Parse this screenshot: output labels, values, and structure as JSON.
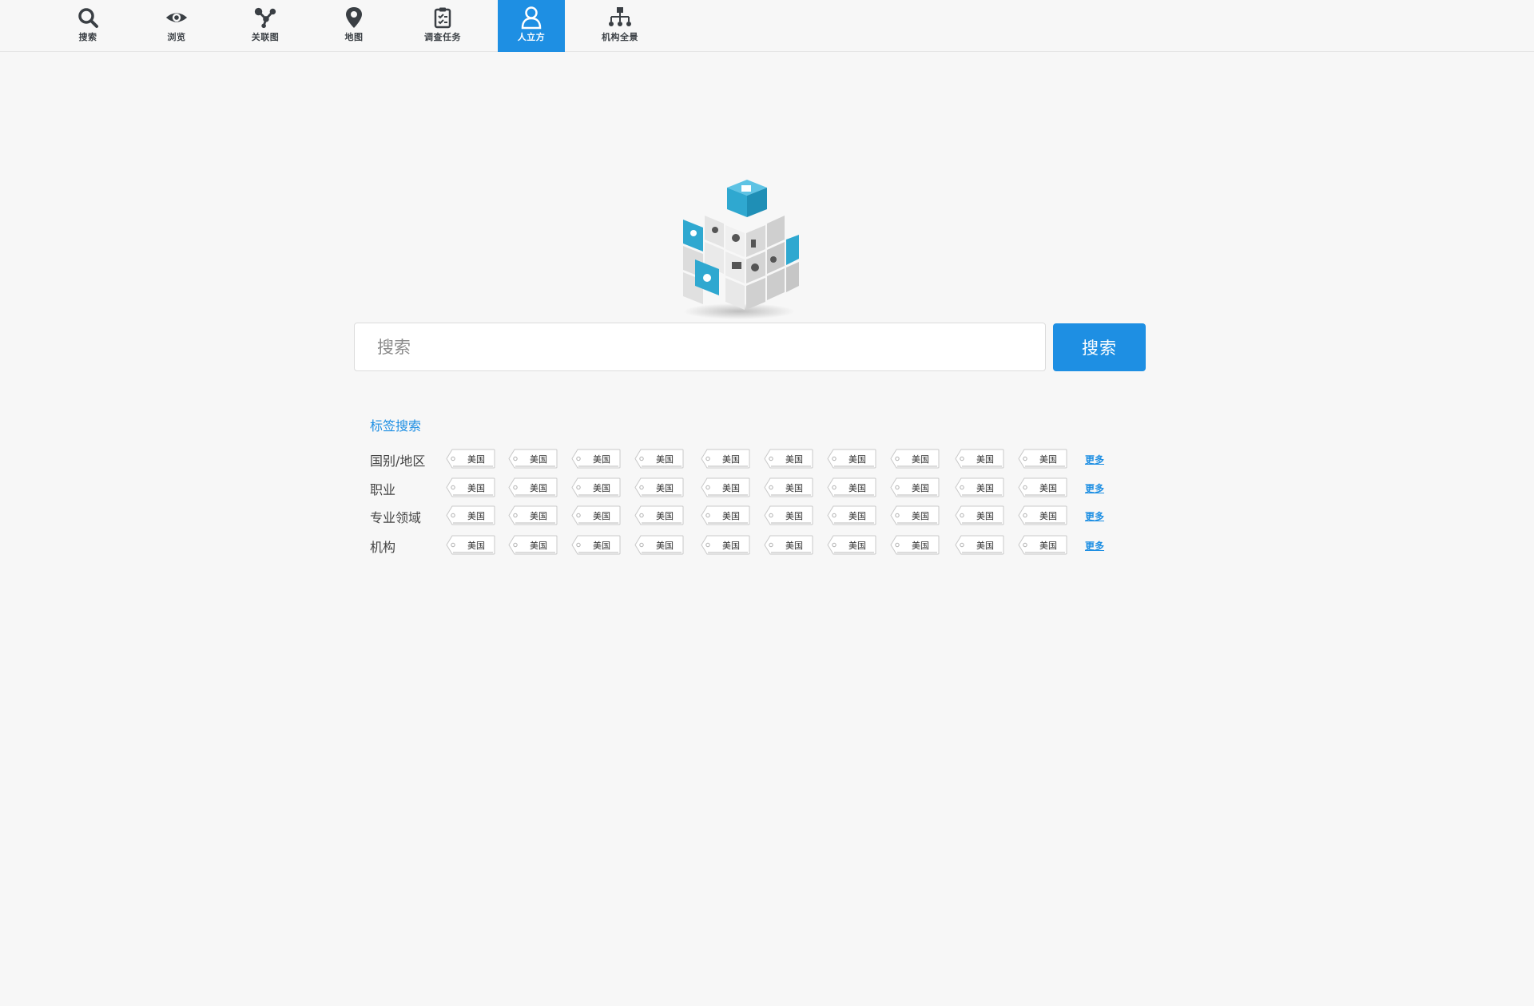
{
  "nav": {
    "items": [
      {
        "label": "搜索",
        "icon": "search-icon"
      },
      {
        "label": "浏览",
        "icon": "eye-icon"
      },
      {
        "label": "关联图",
        "icon": "graph-icon"
      },
      {
        "label": "地图",
        "icon": "map-pin-icon"
      },
      {
        "label": "调查任务",
        "icon": "clipboard-icon"
      },
      {
        "label": "人立方",
        "icon": "person-icon",
        "active": true
      },
      {
        "label": "机构全景",
        "icon": "org-chart-icon"
      }
    ]
  },
  "search": {
    "placeholder": "搜索",
    "button_label": "搜索"
  },
  "tags": {
    "title": "标签搜索",
    "more_label": "更多",
    "rows": [
      {
        "label": "国别/地区",
        "tags": [
          "美国",
          "美国",
          "美国",
          "美国",
          "美国",
          "美国",
          "美国",
          "美国",
          "美国",
          "美国"
        ]
      },
      {
        "label": "职业",
        "tags": [
          "美国",
          "美国",
          "美国",
          "美国",
          "美国",
          "美国",
          "美国",
          "美国",
          "美国",
          "美国"
        ]
      },
      {
        "label": "专业领域",
        "tags": [
          "美国",
          "美国",
          "美国",
          "美国",
          "美国",
          "美国",
          "美国",
          "美国",
          "美国",
          "美国"
        ]
      },
      {
        "label": "机构",
        "tags": [
          "美国",
          "美国",
          "美国",
          "美国",
          "美国",
          "美国",
          "美国",
          "美国",
          "美国",
          "美国"
        ]
      }
    ]
  },
  "colors": {
    "accent": "#1e8fe3",
    "background": "#f7f7f7",
    "cube_blue": "#2fa8d0"
  }
}
